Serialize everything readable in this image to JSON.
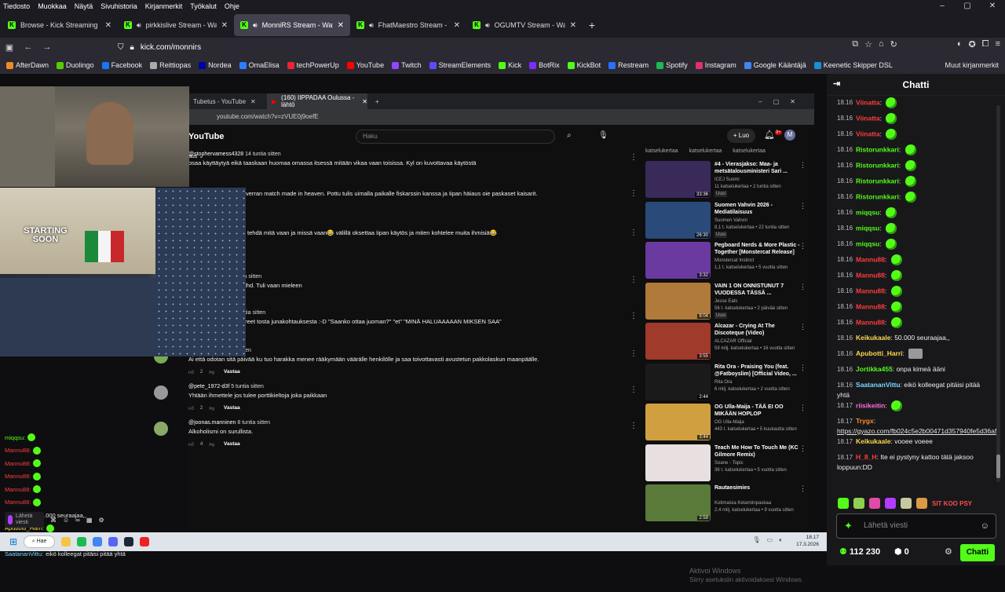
{
  "menubar": {
    "items": [
      "Tiedosto",
      "Muokkaa",
      "Näytä",
      "Sivuhistoria",
      "Kirjanmerkit",
      "Työkalut",
      "Ohje"
    ]
  },
  "window": {
    "minimize": "–",
    "maximize": "▢",
    "close": "✕"
  },
  "tabs": [
    {
      "label": "Browse - Kick Streaming",
      "active": false
    },
    {
      "label": "pirkkislive Stream - Watch Li",
      "active": false
    },
    {
      "label": "MonniRS Stream - Watch Li",
      "active": true
    },
    {
      "label": "FhatMaestro Stream - Watc",
      "active": false
    },
    {
      "label": "OGUMTV Stream - Watch Li",
      "active": false
    }
  ],
  "url": "kick.com/monnirs",
  "bookmarks": [
    {
      "label": "AfterDawn",
      "color": "#f08a24"
    },
    {
      "label": "Duolingo",
      "color": "#58cc02"
    },
    {
      "label": "Facebook",
      "color": "#1877f2"
    },
    {
      "label": "Reittiopas",
      "color": "#aaaaaa"
    },
    {
      "label": "Nordea",
      "color": "#0000a0"
    },
    {
      "label": "OmaElisa",
      "color": "#2a7fff"
    },
    {
      "label": "techPowerUp",
      "color": "#e23"
    },
    {
      "label": "YouTube",
      "color": "#f00"
    },
    {
      "label": "Twitch",
      "color": "#9146ff"
    },
    {
      "label": "StreamElements",
      "color": "#5c4bff"
    },
    {
      "label": "Kick",
      "color": "#53fc18"
    },
    {
      "label": "BotRix",
      "color": "#7b2cff"
    },
    {
      "label": "KickBot",
      "color": "#53fc18"
    },
    {
      "label": "Restream",
      "color": "#2b6fff"
    },
    {
      "label": "Spotify",
      "color": "#1db954"
    },
    {
      "label": "Instagram",
      "color": "#e1306c"
    },
    {
      "label": "Google Kääntäjä",
      "color": "#4285f4"
    },
    {
      "label": "Keenetic Skipper DSL",
      "color": "#1a8fd6"
    }
  ],
  "bookmarks_other": "Muut kirjanmerkit",
  "overlay": {
    "starting": "STARTING SOON"
  },
  "youtube": {
    "tabs": [
      "Tubetus - YouTube",
      "(160) IIPPADAA Oulussa - lähtö"
    ],
    "address": "youtube.com/watch?v=zVUE0j9oefE",
    "logo": "YouTube",
    "search_placeholder": "Haku",
    "create_label": "Luo",
    "bell_badge": "9+",
    "avatar": "M",
    "sort_label": "aus",
    "comments": [
      {
        "author": "@stophervamess4328",
        "time": "14 tuntia sitten",
        "text": "osaa käyttäytyä eikä taaskaan huomaa omassa itsessä mitään vikaa vaan toisissa. Kyl on kuvottavaa käytöstä",
        "likes": "",
        "reply": ""
      },
      {
        "author": "",
        "time": "",
        "text": "u satuhäihin? On sen verran match made in heaven. Pottu tulis uimalla paikalle  fiskarssin kanssa ja Iipan häiaus oie paskaset kaisarit.",
        "likes": "",
        "reply": ""
      },
      {
        "author": "",
        "time": "",
        "text": "ostapoja luulee et saa tehdä mitä vaan ja missä vaan😂 välillä oksettaa Iipan käytös ja miten kohtelee muita  ihmisiä😂",
        "likes": "",
        "reply": ""
      },
      {
        "author": "@Omena-ommi",
        "time": "5 tuntia sitten",
        "text": "Onko iipalla odc tai adhd. Tuli vaan mieleen",
        "likes": "2",
        "reply": "Vastaa"
      },
      {
        "author": "@MikeBeachcola",
        "time": "2 tuntia sitten",
        "text": "Hyi vittu tuli kylmänväreet tosta junakohtauksesta :-D \"Saanko ottaa juoman?\" \"et\" \"MINÄ HALUAAAAAN MIKSEN SAA\"",
        "likes": "3",
        "reply": "Vastaa"
      },
      {
        "author": "@bamppaa",
        "time": "6 tuntia sitten",
        "text": "Ai että odotan sitä päivää ku tuo harakka menee rääkymään väärälle henkilölle ja saa toivottavasti avustetun pakkolaskun maanpäälle.",
        "likes": "2",
        "reply": "Vastaa"
      },
      {
        "author": "@pete_1972-d3f",
        "time": "5 tuntia sitten",
        "text": "Yhtään ihmettele jos tulee porttikieltoja joka paikkaan",
        "likes": "2",
        "reply": "Vastaa"
      },
      {
        "author": "@joonas.manninen",
        "time": "8 tuntia sitten",
        "text": "Alkoholismi on surullista.",
        "likes": "4",
        "reply": "Vastaa"
      }
    ],
    "side_header": [
      "katselukertaa",
      "katselukertaa",
      "katselukertaa"
    ],
    "videos": [
      {
        "title": "#4 - Vierasjakso: Maa- ja metsätalousministeri Sari ...",
        "channel": "ICEJ Suomi",
        "views": "11 katselukertaa • 2 tuntia sitten",
        "badge": "Uusi",
        "duration": "33:36",
        "color": "#3a2a5a"
      },
      {
        "title": "Suomen Vahvin 2026 - Mediatilaisuus",
        "channel": "Suomen Vahvin",
        "views": "8,1 t. katselukertaa • 22 tuntia sitten",
        "badge": "Uusi",
        "duration": "26:30",
        "color": "#2a4a7a"
      },
      {
        "title": "Pegboard Nerds & More Plastic - Together [Monstercat Release]",
        "channel": "Monstercat Instinct",
        "views": "1,1 t. katselukertaa • 5 vuotta sitten",
        "badge": "",
        "duration": "3:32",
        "color": "#6a3aa0"
      },
      {
        "title": "VAIN 1 ON ONNISTUNUT 7 VUODESSA TÄSSÄ ...",
        "channel": "Jesse Eats",
        "views": "56 t. katselukertaa • 2 päivää sitten",
        "badge": "Uusi",
        "duration": "8:04",
        "color": "#b07a3a"
      },
      {
        "title": "Alcazar - Crying At The Discoteque (Video)",
        "channel": "ALCAZAR Official",
        "views": "59 milj. katselukertaa • 16 vuotta sitten",
        "badge": "",
        "duration": "3:55",
        "color": "#a03a2a"
      },
      {
        "title": "Rita Ora - Praising You (feat. @Fatboyslim) [Official Video, ...",
        "channel": "Rita Ora",
        "views": "6 milj. katselukertaa • 2 vuotta sitten",
        "badge": "",
        "duration": "2:44",
        "color": "#1a1a1a"
      },
      {
        "title": "OG Ulla-Maija - TÄÄ EI OO MIKÄÄN HOPLOP",
        "channel": "OG Ulla-Maija",
        "views": "443 t. katselukertaa • 5 kuukautta sitten",
        "badge": "",
        "duration": "3:44",
        "color": "#d0a040"
      },
      {
        "title": "Teach Me How To Touch Me (KC Gilmore Remix)",
        "channel": "Soane - Topic",
        "views": "36 t. katselukertaa • 5 vuotta sitten",
        "badge": "",
        "duration": "",
        "color": "#e8e0e0"
      },
      {
        "title": "Rautaesimies",
        "channel": "Kotimaisia Ketamiinpaskaa",
        "views": "2,4 milj. katselukertaa • 9 vuotta sitten",
        "badge": "",
        "duration": "2:59",
        "color": "#5a7a3a"
      }
    ]
  },
  "left_chat": [
    {
      "user": "miqqsu:",
      "cls": "g",
      "text": ""
    },
    {
      "user": "Mannu88:",
      "cls": "r",
      "text": ""
    },
    {
      "user": "Mannu88:",
      "cls": "r",
      "text": ""
    },
    {
      "user": "Mannu88:",
      "cls": "r",
      "text": ""
    },
    {
      "user": "Mannu88:",
      "cls": "r",
      "text": ""
    },
    {
      "user": "Mannu88:",
      "cls": "r",
      "text": ""
    },
    {
      "user": "Keikukaale:",
      "cls": "y",
      "text": "50.000 seuraajaa,,"
    },
    {
      "user": "Apubotti_Harri:",
      "cls": "y",
      "text": ""
    },
    {
      "user": "Jortikka455:",
      "cls": "g",
      "text": "onpa kimeä ääni"
    },
    {
      "user": "SaatananVittu:",
      "cls": "c",
      "text": "eikö kolleegat pitäisi pitää yhtä"
    }
  ],
  "left_bar": {
    "send_label": "Lähetä viesti"
  },
  "taskbar": {
    "search": "Hae",
    "time": "18.17",
    "date": "17.3.2026"
  },
  "watermark": {
    "line1": "Aktivoi Windows",
    "line2": "Siirry asetuksiin aktivoidaksesi Windows."
  },
  "chat": {
    "title": "Chatti",
    "messages": [
      {
        "time": "18.16",
        "user": "Viinatta",
        "color": "#ff3c3c",
        "text": "",
        "emote": true
      },
      {
        "time": "18.16",
        "user": "Viinatta",
        "color": "#ff3c3c",
        "text": "",
        "emote": true
      },
      {
        "time": "18.16",
        "user": "Viinatta",
        "color": "#ff3c3c",
        "text": "",
        "emote": true
      },
      {
        "time": "18.16",
        "user": "Ristorunkkari",
        "color": "#53fc18",
        "text": "",
        "emote": true
      },
      {
        "time": "18.16",
        "user": "Ristorunkkari",
        "color": "#53fc18",
        "text": "",
        "emote": true
      },
      {
        "time": "18.16",
        "user": "Ristorunkkari",
        "color": "#53fc18",
        "text": "",
        "emote": true
      },
      {
        "time": "18.16",
        "user": "Ristorunkkari",
        "color": "#53fc18",
        "text": "",
        "emote": true
      },
      {
        "time": "18.16",
        "user": "miqqsu",
        "color": "#53fc18",
        "text": "",
        "emote": true
      },
      {
        "time": "18.16",
        "user": "miqqsu",
        "color": "#53fc18",
        "text": "",
        "emote": true
      },
      {
        "time": "18.16",
        "user": "miqqsu",
        "color": "#53fc18",
        "text": "",
        "emote": true
      },
      {
        "time": "18.16",
        "user": "Mannu88",
        "color": "#ff3c3c",
        "text": "",
        "emote": true
      },
      {
        "time": "18.16",
        "user": "Mannu88",
        "color": "#ff3c3c",
        "text": "",
        "emote": true
      },
      {
        "time": "18.16",
        "user": "Mannu88",
        "color": "#ff3c3c",
        "text": "",
        "emote": true
      },
      {
        "time": "18.16",
        "user": "Mannu88",
        "color": "#ff3c3c",
        "text": "",
        "emote": true
      },
      {
        "time": "18.16",
        "user": "Mannu88",
        "color": "#ff3c3c",
        "text": "",
        "emote": true
      },
      {
        "time": "18.16",
        "user": "Keikukaale",
        "color": "#ffd84d",
        "text": "50.000 seuraajaa,,",
        "emote": false
      },
      {
        "time": "18.16",
        "user": "Apubotti_Harri",
        "color": "#ffd84d",
        "text": "",
        "emote": false,
        "image": true
      },
      {
        "time": "18.16",
        "user": "Jortikka455",
        "color": "#53fc18",
        "text": "onpa kimeä ääni",
        "emote": false
      },
      {
        "time": "18.16",
        "user": "SaatananVittu",
        "color": "#7ad7ff",
        "text": "eikö kolleegat pitäisi pitää yhtä",
        "emote": false
      },
      {
        "time": "18.17",
        "user": "riisikeitin",
        "color": "#ff6fd8",
        "text": "",
        "emote": true
      },
      {
        "time": "18.17",
        "user": "Trygx",
        "color": "#ff8a24",
        "text": "https://gyazo.com/fb024c5e2b00471d357940fe5d36afdf",
        "emote": false,
        "link": true
      },
      {
        "time": "18.17",
        "user": "Keikukaale",
        "color": "#ffd84d",
        "text": "vooee voeee",
        "emote": false
      },
      {
        "time": "18.17",
        "user": "H_8_H",
        "color": "#ff3c3c",
        "text": "Ite ei pystyny kattoo tätä jaksoo loppuun:DD",
        "emote": false
      }
    ],
    "emote_bar_text": "SIT KOO PSY",
    "input_placeholder": "Lähetä viesti",
    "viewers": "112 230",
    "second_count": "0",
    "send_button": "Chatti"
  }
}
